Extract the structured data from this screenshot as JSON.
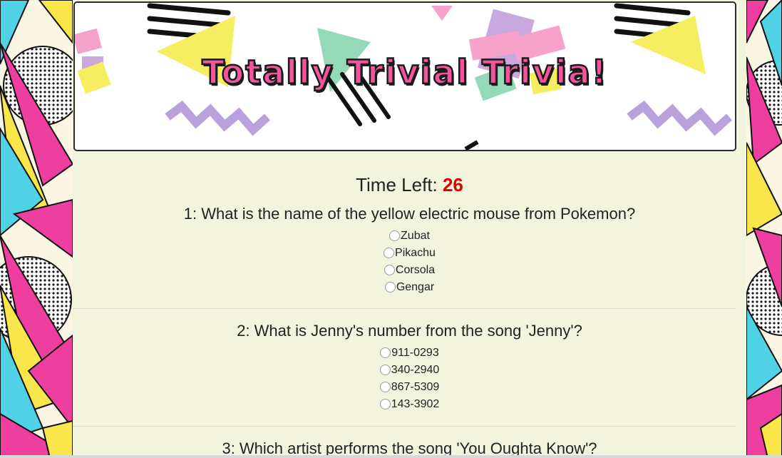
{
  "banner": {
    "title": "Totally Trivial Trivia!"
  },
  "timer": {
    "label": "Time Left: ",
    "value": "26"
  },
  "questions": [
    {
      "text": "1: What is the name of the yellow electric mouse from Pokemon?",
      "options": [
        "Zubat",
        "Pikachu",
        "Corsola",
        "Gengar"
      ]
    },
    {
      "text": "2: What is Jenny's number from the song 'Jenny'?",
      "options": [
        "911-0293",
        "340-2940",
        "867-5309",
        "143-3902"
      ]
    },
    {
      "text": "3: Which artist performs the song 'You Oughta Know'?"
    }
  ],
  "colors": {
    "pink": "#ee3fa0",
    "yellow": "#f9e64a",
    "cyan": "#4fd2e6",
    "timer_red": "#e00000",
    "panel_bg": "#f2f4de"
  }
}
